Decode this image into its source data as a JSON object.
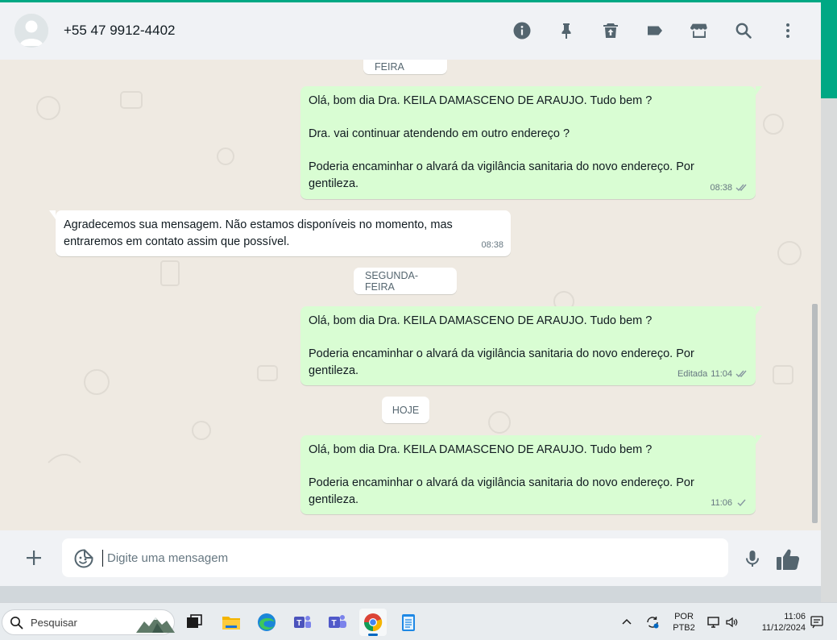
{
  "header": {
    "contact_name": "+55 47 9912-4402",
    "icons": [
      "info-icon",
      "pin-icon",
      "delete-icon",
      "label-icon",
      "catalog-icon",
      "search-icon",
      "menu-icon"
    ]
  },
  "chat": {
    "date_top": "SEXTA-FEIRA",
    "messages_friday": [
      {
        "direction": "out",
        "lines": [
          "Olá, bom dia Dra. KEILA DAMASCENO DE ARAUJO. Tudo bem ?",
          "",
          "Dra. vai continuar atendendo em outro endereço ?",
          "",
          "Poderia encaminhar o alvará da vigilância sanitaria do novo endereço. Por",
          "gentileza."
        ],
        "time": "08:38",
        "status": "read"
      },
      {
        "direction": "in",
        "lines": [
          "Agradecemos sua mensagem. Não estamos disponíveis no momento, mas",
          "entraremos em contato assim que possível."
        ],
        "time": "08:38"
      }
    ],
    "date_monday": "SEGUNDA-FEIRA",
    "message_monday": {
      "direction": "out",
      "lines": [
        "Olá, bom dia Dra. KEILA DAMASCENO DE ARAUJO. Tudo bem ?",
        "",
        "Poderia encaminhar o alvará da vigilância sanitaria do novo endereço. Por",
        "gentileza."
      ],
      "edited_label": "Editada",
      "time": "11:04",
      "status": "read"
    },
    "date_today": "HOJE",
    "message_today": {
      "direction": "out",
      "lines": [
        "Olá, bom dia Dra. KEILA DAMASCENO DE ARAUJO. Tudo bem ?",
        "",
        "Poderia encaminhar o alvará da vigilância sanitaria do novo endereço. Por",
        "gentileza."
      ],
      "time": "11:06",
      "status": "sent"
    }
  },
  "composer": {
    "placeholder": "Digite uma mensagem",
    "value": ""
  },
  "taskbar": {
    "search_label": "Pesquisar",
    "apps": [
      "task-view-icon",
      "file-explorer-icon",
      "edge-icon",
      "teams-icon",
      "teams-work-icon",
      "chrome-icon",
      "notepad-icon"
    ],
    "active_app": "chrome-icon",
    "lang_line1": "POR",
    "lang_line2": "PTB2",
    "time": "11:06",
    "date": "11/12/2024"
  },
  "colors": {
    "accent": "#00a884",
    "outgoing_bubble": "#d9fdd3",
    "incoming_bubble": "#ffffff",
    "read_tick": "#667781",
    "chat_bg": "#efeae2",
    "panel_bg": "#f0f2f5"
  }
}
